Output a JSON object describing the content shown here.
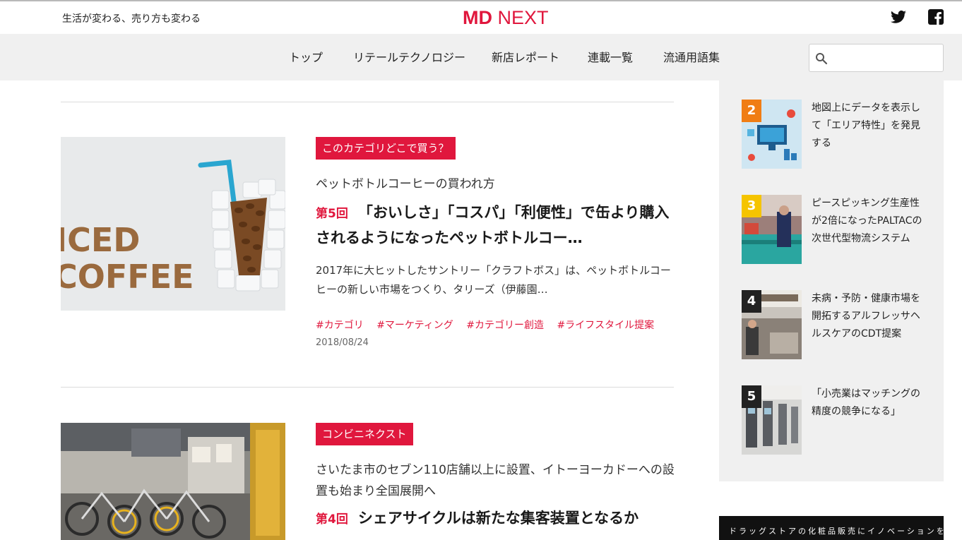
{
  "header": {
    "tagline": "生活が変わる、売り方も変わる",
    "logo_md": "MD",
    "logo_next": " NEXT",
    "social": [
      "twitter-icon",
      "facebook-icon"
    ]
  },
  "nav": {
    "items": [
      "トップ",
      "リテールテクノロジー",
      "新店レポート",
      "連載一覧",
      "流通用語集"
    ],
    "search_placeholder": ""
  },
  "articles": [
    {
      "category": "このカテゴリどこで買う？",
      "subtitle": "ペットボトルコーヒーの買われ方",
      "episode": "第5回",
      "title": "「おいしさ」「コスパ」「利便性」で缶より購入されるようになったペットボトルコー…",
      "excerpt": "2017年に大ヒットしたサントリー「クラフトボス」は、ペットボトルコーヒーの新しい市場をつくり、タリーズ（伊藤園…",
      "tags": [
        "#カテゴリ",
        "#マーケティング",
        "#カテゴリー創造",
        "#ライフスタイル提案"
      ],
      "date": "2018/08/24",
      "image_text": [
        "ICED",
        "COFFEE"
      ]
    },
    {
      "category": "コンビニネクスト",
      "subtitle": "さいたま市のセブン110店舗以上に設置、イトーヨーカドーへの設置も始まり全国展開へ",
      "episode": "第4回",
      "title": "シェアサイクルは新たな集客装置となるか"
    }
  ],
  "ranking": [
    {
      "rank": "2",
      "title": "地図上にデータを表示して「エリア特性」を発見する",
      "color": "#f07d14"
    },
    {
      "rank": "3",
      "title": "ピースピッキング生産性が2倍になったPALTACの次世代型物流システム",
      "color": "#f5c400"
    },
    {
      "rank": "4",
      "title": "未病・予防・健康市場を開拓するアルフレッサヘルスケアのCDT提案",
      "color": "#222222"
    },
    {
      "rank": "5",
      "title": "「小売業はマッチングの精度の競争になる」",
      "color": "#222222"
    }
  ],
  "banner": {
    "text": "ドラッグストアの化粧品販売にイノベーションを"
  },
  "colors": {
    "accent": "#e0173d",
    "nav_bg": "#f0f0f0"
  }
}
